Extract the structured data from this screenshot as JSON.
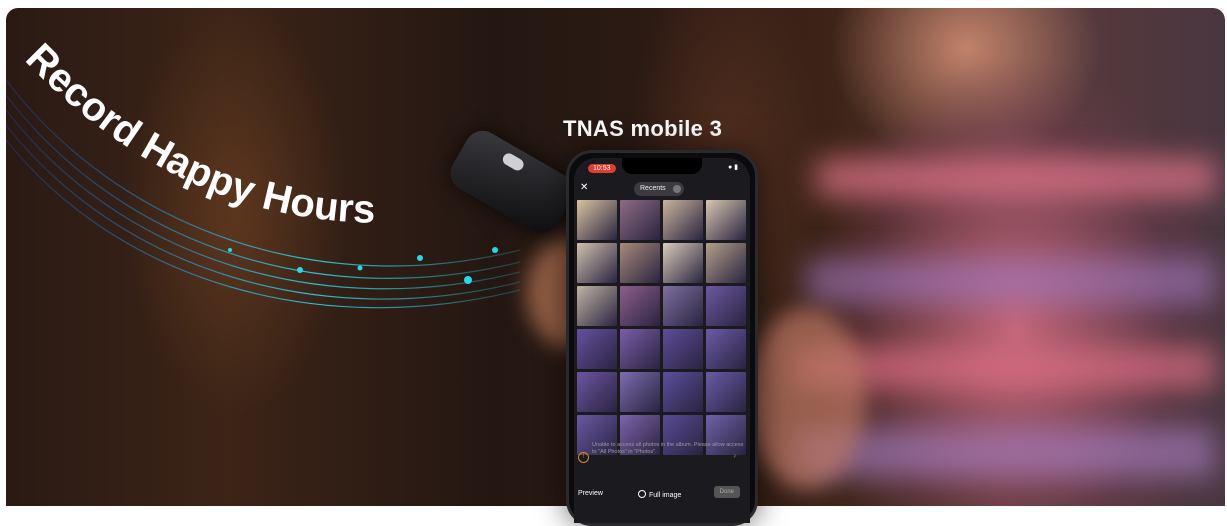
{
  "banner": {
    "headline": "Record Happy Hours",
    "app_title": "TNAS mobile 3"
  },
  "phone": {
    "status_time": "10:53",
    "nav": {
      "close_icon": "close-icon",
      "album_label": "Recents"
    },
    "warning": {
      "icon": "warning-icon",
      "text": "Unable to access all photos in the album. Please allow access to \"All Photos\" in \"Photos\"."
    },
    "bottom_bar": {
      "preview_label": "Preview",
      "full_image_label": "Full image",
      "done_label": "Done"
    },
    "thumbnail_colors": [
      "#d9c3a0",
      "#8e6c84",
      "#c8b49a",
      "#d6c7b0",
      "#cfc1ad",
      "#a78a7a",
      "#d7ccb8",
      "#b3a088",
      "#c0b4a2",
      "#8e5f88",
      "#7d6fa0",
      "#6c58a0",
      "#6650a0",
      "#7a5da8",
      "#5e4c9a",
      "#6b5aa8",
      "#6c55a2",
      "#7c6cb0",
      "#5c4f9c",
      "#6a5ba6",
      "#6a58a4",
      "#7e64ae",
      "#5a4b96",
      "#7162aa"
    ]
  },
  "colors": {
    "accent_glow": "#27d8e8",
    "status_red": "#e23b30"
  }
}
